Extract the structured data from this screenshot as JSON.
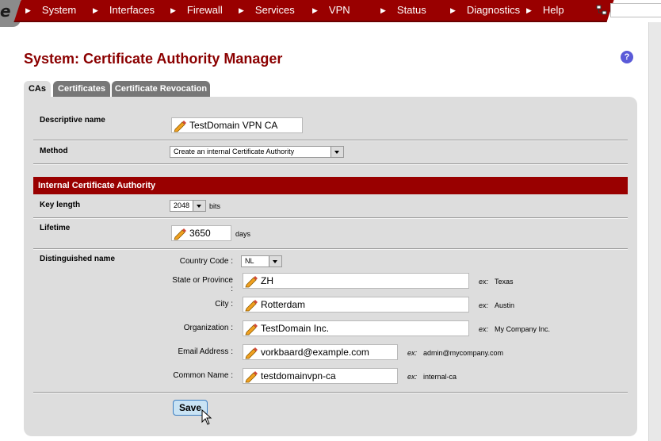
{
  "nav": {
    "items": [
      "System",
      "Interfaces",
      "Firewall",
      "Services",
      "VPN",
      "Status",
      "Diagnostics",
      "Help"
    ],
    "logo_letter": "e"
  },
  "page": {
    "title": "System: Certificate Authority Manager",
    "help_symbol": "?"
  },
  "tabs": [
    {
      "label": "CAs",
      "active": true
    },
    {
      "label": "Certificates",
      "active": false
    },
    {
      "label": "Certificate Revocation",
      "active": false
    }
  ],
  "form": {
    "descriptive_name_label": "Descriptive name",
    "descriptive_name_value": "TestDomain VPN CA",
    "method_label": "Method",
    "method_value": "Create an internal Certificate Authority",
    "section_title": "Internal Certificate Authority",
    "key_length_label": "Key length",
    "key_length_value": "2048",
    "key_length_unit": "bits",
    "lifetime_label": "Lifetime",
    "lifetime_value": "3650",
    "lifetime_unit": "days",
    "dn_label": "Distinguished name",
    "country_label": "Country Code :",
    "country_value": "NL",
    "state_label": "State or Province :",
    "state_value": "ZH",
    "state_example": "Texas",
    "city_label": "City :",
    "city_value": "Rotterdam",
    "city_example": "Austin",
    "org_label": "Organization :",
    "org_value": "TestDomain Inc.",
    "org_example": "My Company Inc.",
    "email_label": "Email Address :",
    "email_value": "vorkbaard@example.com",
    "email_example": "admin@mycompany.com",
    "cn_label": "Common Name :",
    "cn_value": "testdomainvpn-ca",
    "cn_example": "internal-ca",
    "ex_prefix": "ex:",
    "save_label": "Save"
  },
  "colors": {
    "brand_red": "#990000",
    "title_red": "#8b0000",
    "panel_gray": "#dddddd"
  }
}
